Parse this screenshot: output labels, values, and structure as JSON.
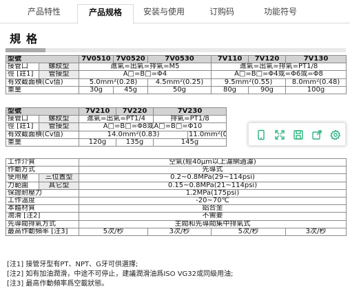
{
  "tabs": [
    {
      "label": "产品特性",
      "active": false
    },
    {
      "label": "产品规格",
      "active": true
    },
    {
      "label": "安装与使用",
      "active": false
    },
    {
      "label": "订购码",
      "active": false
    },
    {
      "label": "功能符号",
      "active": false
    }
  ],
  "section_title": "規格",
  "table1": {
    "model_label": "型號",
    "models": [
      "7V0510",
      "7V0520",
      "7V0530",
      "7V110",
      "7V120",
      "7V130"
    ],
    "port_label_1": "接管口",
    "port_label_2": "徑 [註1]",
    "thread_label": "螺紋型",
    "tube_label": "管接型",
    "thread_a": "進氣=出氣=排氣=M5",
    "thread_b": "進氣=出氣=排氣=PT1/8",
    "tube_a": "A□=B□=Φ4",
    "tube_b": "A□=B□=Φ4或=Φ6或=Φ8",
    "cv_label": "有效截面積(Cv值)",
    "cv": [
      "5.0mm²(0.28)",
      "4.5mm²(0.25)",
      "9.5mm²(0.55)",
      "8.0mm²(0.48)"
    ],
    "weight_label": "重量",
    "weights": [
      "30g",
      "45g",
      "50g",
      "80g",
      "90g",
      "100g"
    ]
  },
  "table2": {
    "model_label": "型號",
    "models": [
      "7V210",
      "7V220",
      "7V230"
    ],
    "port_label_1": "接管口",
    "port_label_2": "徑 [註1]",
    "thread_label": "螺紋型",
    "tube_label": "管接型",
    "thread_a": "進氣=出氣=PT1/4",
    "thread_b": "排氣=PT1/8",
    "tube_a": "A□=B□=Φ8或A□=B□=Φ10",
    "cv_label": "有效截面積(Cv值)",
    "cv": [
      "14.0mm²(0.83)",
      "11.0mm²(0.61)"
    ],
    "weight_label": "重量",
    "weights": [
      "120g",
      "135g",
      "145g"
    ]
  },
  "table3": {
    "rows": [
      {
        "label": "工作介質",
        "value": "空氣(經40μm以上濾網過濾)"
      },
      {
        "label": "作動方式",
        "value": "先導式"
      },
      {
        "label": "使用壓",
        "sub": "三位置型",
        "value": "0.2~0.8MPa(29~114psi)"
      },
      {
        "label": "力範圍",
        "sub": "其它型",
        "value": "0.15~0.8MPa(21~114psi)"
      },
      {
        "label": "保證耐壓力",
        "value": "1.2MPa(175psi)"
      },
      {
        "label": "工作溫度",
        "value": "-20~70℃"
      },
      {
        "label": "本體材質",
        "value": "鋁合金"
      },
      {
        "label": "潤滑 [注2]",
        "value": "不需要"
      },
      {
        "label": "先導閥排氣方式",
        "value": "主閥和先導閥集中排氣式"
      }
    ],
    "freq_label": "最高作動頻率 [注3]",
    "freq": [
      "5次/秒",
      "3次/秒",
      "5次/秒",
      "3次/秒"
    ]
  },
  "notes": [
    "[注1] 接管牙型有PT、NPT、G牙可供選擇;",
    "[注2] 如有加油潤滑，中途不可停止，建議潤滑油爲ISO VG32或同級用油;",
    "[注3] 最高作動頻率爲空載狀態。"
  ],
  "toolbar_icons": [
    "phone-icon",
    "expand-icon",
    "save-icon",
    "share-icon",
    "settings-icon"
  ],
  "colors": {
    "accent": "#2bb37e",
    "header_bg": "#d3d3d3"
  }
}
